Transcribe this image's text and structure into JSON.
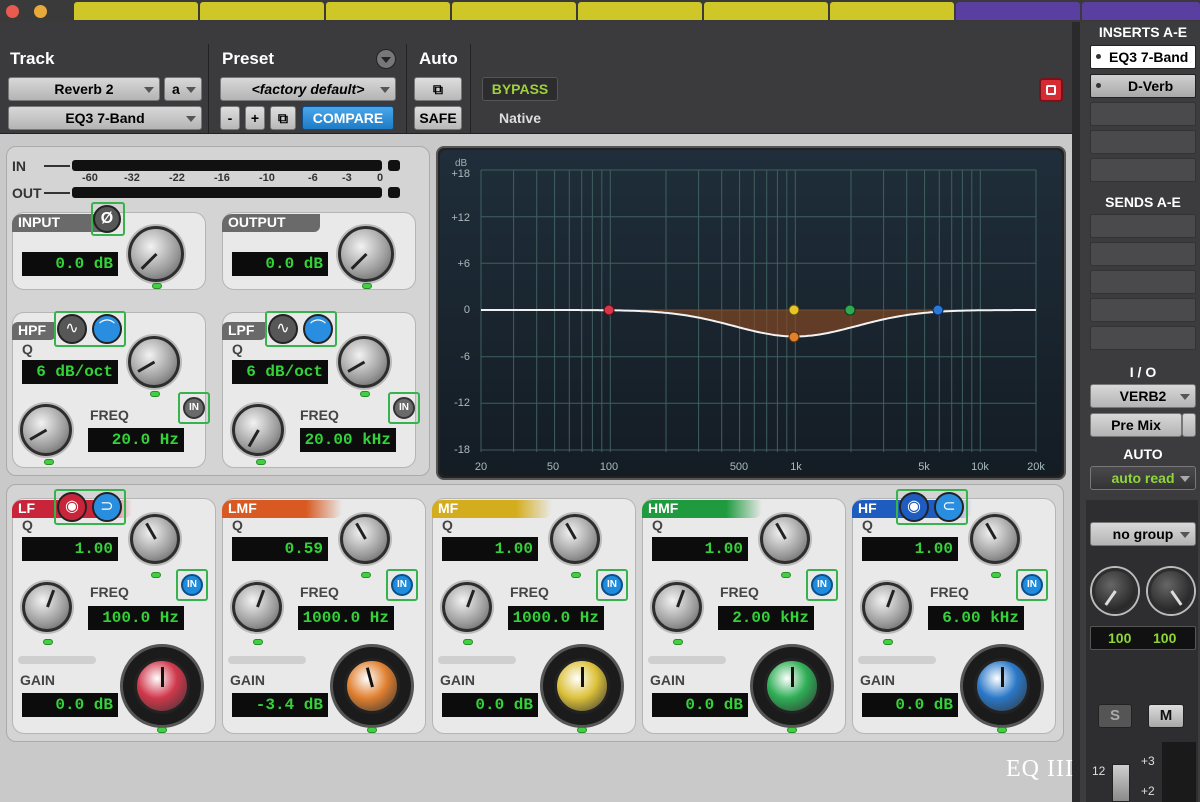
{
  "header": {
    "track_label": "Track",
    "preset_label": "Preset",
    "auto_label": "Auto",
    "track_name": "Reverb 2",
    "track_chain": "a",
    "plugin_name": "EQ3 7-Band",
    "preset_name": "<factory default>",
    "minus": "-",
    "plus": "+",
    "compare": "COMPARE",
    "safe": "SAFE",
    "bypass": "BYPASS",
    "native": "Native"
  },
  "meters": {
    "in_label": "IN",
    "out_label": "OUT",
    "scale": [
      "-60",
      "-32",
      "-22",
      "-16",
      "-10",
      "-6",
      "-3",
      "0"
    ]
  },
  "input": {
    "label": "INPUT",
    "value": "0.0 dB",
    "phase_icon": "Ø"
  },
  "output": {
    "label": "OUTPUT",
    "value": "0.0 dB"
  },
  "hpf": {
    "label": "HPF",
    "q_label": "Q",
    "q_value": "6 dB/oct",
    "freq_label": "FREQ",
    "freq_value": "20.0 Hz",
    "in": "IN"
  },
  "lpf": {
    "label": "LPF",
    "q_label": "Q",
    "q_value": "6 dB/oct",
    "freq_label": "FREQ",
    "freq_value": "20.00 kHz",
    "in": "IN"
  },
  "graph": {
    "y_unit": "dB",
    "y_ticks": [
      "+18",
      "+12",
      "+6",
      "0",
      "-6",
      "-12",
      "-18"
    ],
    "x_ticks": [
      "20",
      "50",
      "100",
      "500",
      "1k",
      "5k",
      "10k",
      "20k"
    ]
  },
  "bands": [
    {
      "id": "lf",
      "label": "LF",
      "color": "#c8243a",
      "q_label": "Q",
      "q": "1.00",
      "freq_label": "FREQ",
      "freq": "100.0 Hz",
      "gain_label": "GAIN",
      "gain": "0.0 dB",
      "in": "IN",
      "knob": "#d0384c"
    },
    {
      "id": "lmf",
      "label": "LMF",
      "color": "#d85a22",
      "q_label": "Q",
      "q": "0.59",
      "freq_label": "FREQ",
      "freq": "1000.0 Hz",
      "gain_label": "GAIN",
      "gain": "-3.4 dB",
      "in": "IN",
      "knob": "#e08030"
    },
    {
      "id": "mf",
      "label": "MF",
      "color": "#d4ad1e",
      "q_label": "Q",
      "q": "1.00",
      "freq_label": "FREQ",
      "freq": "1000.0 Hz",
      "gain_label": "GAIN",
      "gain": "0.0 dB",
      "in": "IN",
      "knob": "#dcc13a"
    },
    {
      "id": "hmf",
      "label": "HMF",
      "color": "#1f9a3e",
      "q_label": "Q",
      "q": "1.00",
      "freq_label": "FREQ",
      "freq": "2.00 kHz",
      "gain_label": "GAIN",
      "gain": "0.0 dB",
      "in": "IN",
      "knob": "#2fae56"
    },
    {
      "id": "hf",
      "label": "HF",
      "color": "#1e5cc0",
      "q_label": "Q",
      "q": "1.00",
      "freq_label": "FREQ",
      "freq": "6.00 kHz",
      "gain_label": "GAIN",
      "gain": "0.0 dB",
      "in": "IN",
      "knob": "#2a78c8"
    }
  ],
  "logo": "EQ III",
  "strip": {
    "inserts_label": "INSERTS A-E",
    "inserts": [
      "EQ3 7-Band",
      "D-Verb"
    ],
    "sends_label": "SENDS A-E",
    "io_label": "I / O",
    "output": "VERB2",
    "premix": "Pre Mix",
    "auto_label": "AUTO",
    "auto_mode": "auto read",
    "group": "no group",
    "pan_left": "100",
    "pan_right": "100",
    "solo": "S",
    "mute": "M",
    "fader_12": "12",
    "fader_p3": "+3",
    "fader_p2": "+2"
  }
}
